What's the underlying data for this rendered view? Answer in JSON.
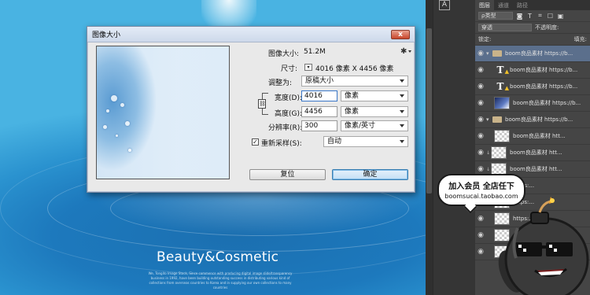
{
  "canvas": {
    "headline": "Beauty&Cosmetic",
    "body_text": "We, Tongito Image Stock, Since commence with producing digital image slide/transparency business in 1992, have been building outstanding success in distributing various kind of collections from overseas countries to Korea and in supplying our own collections to many countries"
  },
  "tools": {
    "character_tool": "A"
  },
  "layers_panel": {
    "tabs": [
      "图层",
      "通道",
      "路径"
    ],
    "kind_filter": "ρ类型",
    "blend_mode": "穿透",
    "opacity_label": "不透明度:",
    "lock_label": "锁定:",
    "fill_label": "填充:",
    "filter_icons": [
      "◙",
      "T",
      "⌗",
      "☐",
      "▣"
    ],
    "rows": [
      {
        "label": "boom良品素材 https://b...",
        "kind": "folder",
        "selected": true
      },
      {
        "label": "boom良品素材 https://b...",
        "kind": "text"
      },
      {
        "label": "boom良品素材 https://b...",
        "kind": "text"
      },
      {
        "label": "boom良品素材 https://b...",
        "kind": "image"
      },
      {
        "label": "boom良品素材 https://b...",
        "kind": "folder"
      },
      {
        "label": "boom良品素材 htt...",
        "kind": "smart"
      },
      {
        "label": "boom良品素材 htt...",
        "kind": "smart"
      },
      {
        "label": "boom良品素材 htt...",
        "kind": "smart"
      },
      {
        "label": "https:...",
        "kind": "smart"
      },
      {
        "label": "https:...",
        "kind": "smart"
      },
      {
        "label": "https:...",
        "kind": "smart"
      },
      {
        "label": "",
        "kind": "smart"
      },
      {
        "label": "",
        "kind": "smart"
      },
      {
        "label": "",
        "kind": "smart"
      }
    ]
  },
  "dialog": {
    "title": "图像大小",
    "image_size_label": "图像大小:",
    "image_size_value": "51.2M",
    "dimensions_label": "尺寸:",
    "dimensions_value": "4016 像素  X  4456 像素",
    "fit_to_label": "调整为:",
    "fit_to_value": "原稿大小",
    "width_label": "宽度(D):",
    "width_value": "4016",
    "width_unit": "像素",
    "height_label": "高度(G):",
    "height_value": "4456",
    "height_unit": "像素",
    "resolution_label": "分辨率(R):",
    "resolution_value": "300",
    "resolution_unit": "像素/英寸",
    "resample_label": "重新采样(S):",
    "resample_checked": true,
    "resample_value": "自动",
    "reset_button": "复位",
    "ok_button": "确定",
    "close_glyph": "x",
    "dims_toggle_glyph": "▾",
    "gear_glyph": "✱",
    "link_glyph": "⛓"
  },
  "promo": {
    "line1": "加入会员 全店任下",
    "line2": "boomsucai.taobao.com"
  }
}
